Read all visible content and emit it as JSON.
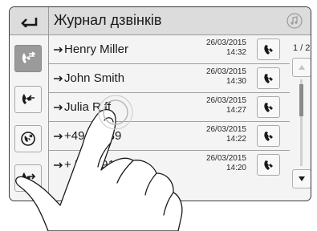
{
  "header": {
    "title": "Журнал дзвінків"
  },
  "icons": {
    "back": "back-arrow-icon",
    "media": "music-note-icon",
    "call": "phone-handset-icon"
  },
  "sidebar": {
    "items": [
      {
        "name": "all-calls",
        "icon": "phone-all-calls-icon",
        "active": true
      },
      {
        "name": "received-calls",
        "icon": "phone-incoming-icon",
        "active": false
      },
      {
        "name": "missed-calls",
        "icon": "phone-missed-icon",
        "active": false
      },
      {
        "name": "dialed-calls",
        "icon": "phone-outgoing-icon",
        "active": false
      }
    ]
  },
  "calls": [
    {
      "name": "Henry Miller",
      "date": "26/03/2015",
      "time": "14:32"
    },
    {
      "name": "John Smith",
      "date": "26/03/2015",
      "time": "14:30"
    },
    {
      "name": "Julia R    ff",
      "date": "26/03/2015",
      "time": "14:27"
    },
    {
      "name": "+49     56789",
      "date": "26/03/2015",
      "time": "14:22"
    },
    {
      "name": "+     567891",
      "date": "26/03/2015",
      "time": "14:20"
    }
  ],
  "pager": {
    "label": "1 / 2"
  },
  "scrollbar": {
    "position_fraction": 0.0
  },
  "colors": {
    "titlebar": "#dcdcdc",
    "active_tab": "#9a9a9a",
    "screen_bg": "#f4f4f4"
  }
}
